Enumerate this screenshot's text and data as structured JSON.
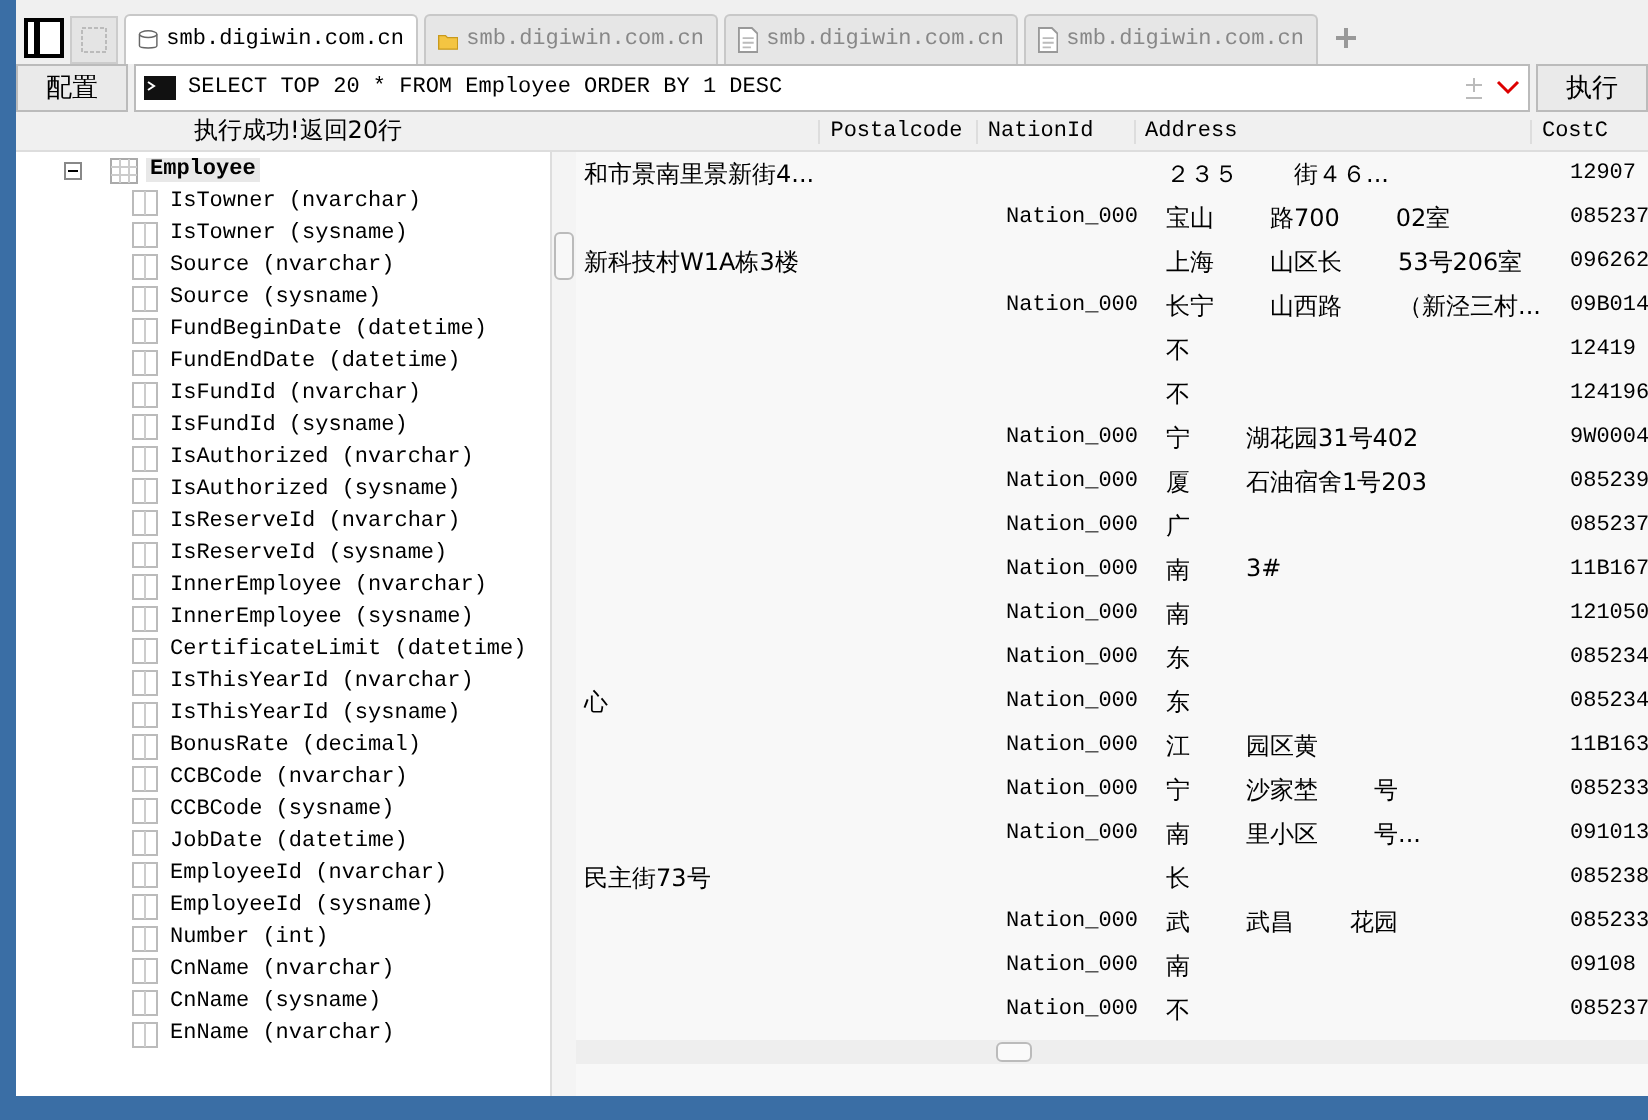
{
  "tabs": [
    {
      "label": "smb.digiwin.com.cn",
      "kind": "database",
      "selected": true
    },
    {
      "label": "smb.digiwin.com.cn",
      "kind": "folder",
      "selected": false
    },
    {
      "label": "smb.digiwin.com.cn",
      "kind": "document",
      "selected": false
    },
    {
      "label": "smb.digiwin.com.cn",
      "kind": "document",
      "selected": false
    }
  ],
  "toolbar": {
    "config_button": "配置",
    "query": "SELECT TOP 20 * FROM Employee ORDER BY 1 DESC",
    "run_button": "执行"
  },
  "status": "执行成功!返回20行",
  "tree": {
    "label": "Employee",
    "expanded": true,
    "selected": true,
    "children": [
      {
        "label": "IsTowner (nvarchar)"
      },
      {
        "label": "IsTowner (sysname)"
      },
      {
        "label": "Source (nvarchar)"
      },
      {
        "label": "Source (sysname)"
      },
      {
        "label": "FundBeginDate (datetime)"
      },
      {
        "label": "FundEndDate (datetime)"
      },
      {
        "label": "IsFundId (nvarchar)"
      },
      {
        "label": "IsFundId (sysname)"
      },
      {
        "label": "IsAuthorized (nvarchar)"
      },
      {
        "label": "IsAuthorized (sysname)"
      },
      {
        "label": "IsReserveId (nvarchar)"
      },
      {
        "label": "IsReserveId (sysname)"
      },
      {
        "label": "InnerEmployee (nvarchar)"
      },
      {
        "label": "InnerEmployee (sysname)"
      },
      {
        "label": "CertificateLimit (datetime)"
      },
      {
        "label": "IsThisYearId (nvarchar)"
      },
      {
        "label": "IsThisYearId (sysname)"
      },
      {
        "label": "BonusRate (decimal)"
      },
      {
        "label": "CCBCode (nvarchar)"
      },
      {
        "label": "CCBCode (sysname)"
      },
      {
        "label": "JobDate (datetime)"
      },
      {
        "label": "EmployeeId (nvarchar)"
      },
      {
        "label": "EmployeeId (sysname)"
      },
      {
        "label": "Number (int)"
      },
      {
        "label": "CnName (nvarchar)"
      },
      {
        "label": "CnName (sysname)"
      },
      {
        "label": "EnName (nvarchar)"
      }
    ]
  },
  "table": {
    "columns": [
      "Postalcode",
      "NationId",
      "Address",
      "CostC"
    ],
    "rows": [
      {
        "column_1": "和市景南里景新街4...",
        "nation": "",
        "address": [
          "２３５",
          "街４６..."
        ],
        "cost": "12907"
      },
      {
        "column_1": "",
        "nation": "Nation_000",
        "address": [
          "宝山",
          "路700",
          "02室"
        ],
        "cost": "085237"
      },
      {
        "column_1": "新科技村W1A栋3楼",
        "nation": "",
        "address": [
          "上海",
          "山区长",
          "53号206室"
        ],
        "cost": "096262"
      },
      {
        "column_1": "",
        "nation": "Nation_000",
        "address": [
          "长宁",
          "山西路",
          "（新泾三村..."
        ],
        "cost": "09B014"
      },
      {
        "column_1": "",
        "nation": "",
        "address": [
          "不"
        ],
        "cost": "12419"
      },
      {
        "column_1": "",
        "nation": "",
        "address": [
          "不"
        ],
        "cost": "124196"
      },
      {
        "column_1": "",
        "nation": "Nation_000",
        "address": [
          "宁",
          "湖花园31号402"
        ],
        "cost": "9W0004"
      },
      {
        "column_1": "",
        "nation": "Nation_000",
        "address": [
          "厦",
          "石油宿舍1号203"
        ],
        "cost": "085239"
      },
      {
        "column_1": "",
        "nation": "Nation_000",
        "address": [
          "广"
        ],
        "cost": "085237"
      },
      {
        "column_1": "",
        "nation": "Nation_000",
        "address": [
          "南",
          "3#"
        ],
        "cost": "11B167"
      },
      {
        "column_1": "",
        "nation": "Nation_000",
        "address": [
          "南"
        ],
        "cost": "121050"
      },
      {
        "column_1": "",
        "nation": "Nation_000",
        "address": [
          "东"
        ],
        "cost": "085234"
      },
      {
        "column_1": "心",
        "nation": "Nation_000",
        "address": [
          "东"
        ],
        "cost": "085234"
      },
      {
        "column_1": "",
        "nation": "Nation_000",
        "address": [
          "江",
          "园区黄"
        ],
        "cost": "11B163"
      },
      {
        "column_1": "",
        "nation": "Nation_000",
        "address": [
          "宁",
          "沙家埜",
          "号"
        ],
        "cost": "085233"
      },
      {
        "column_1": "",
        "nation": "Nation_000",
        "address": [
          "南",
          "里小区",
          "号..."
        ],
        "cost": "091013"
      },
      {
        "column_1": "民主街73号",
        "nation": "",
        "address": [
          "长"
        ],
        "cost": "085238"
      },
      {
        "column_1": "",
        "nation": "Nation_000",
        "address": [
          "武",
          "武昌",
          "花园"
        ],
        "cost": "085233"
      },
      {
        "column_1": "",
        "nation": "Nation_000",
        "address": [
          "南"
        ],
        "cost": "09108"
      },
      {
        "column_1": "",
        "nation": "Nation_000",
        "address": [
          "不"
        ],
        "cost": "085237"
      }
    ]
  }
}
